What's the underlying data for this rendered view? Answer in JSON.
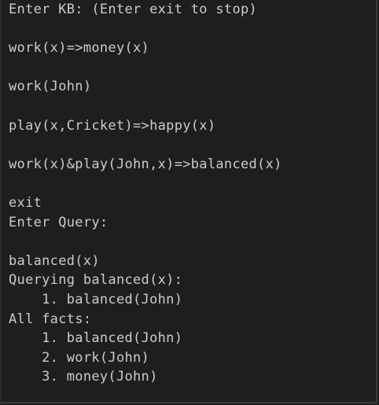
{
  "terminal": {
    "lines": [
      "Enter KB: (Enter exit to stop)",
      "",
      "work(x)=>money(x)",
      "",
      "work(John)",
      "",
      "play(x,Cricket)=>happy(x)",
      "",
      "work(x)&play(John,x)=>balanced(x)",
      "",
      "exit",
      "Enter Query:",
      "",
      "balanced(x)",
      "Querying balanced(x):",
      "    1. balanced(John)",
      "All facts:",
      "    1. balanced(John)",
      "    2. work(John)",
      "    3. money(John)"
    ]
  },
  "colors": {
    "background": "#1e1e1e",
    "text": "#cccccc",
    "border": "#3c3c3c"
  }
}
